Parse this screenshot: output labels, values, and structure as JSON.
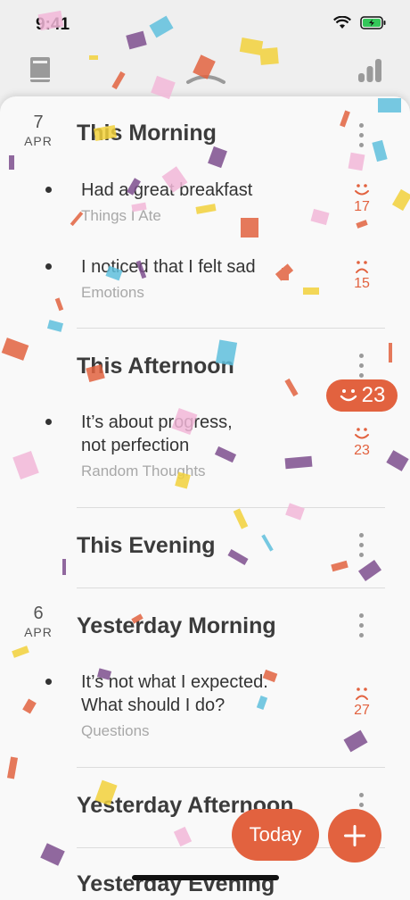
{
  "status": {
    "time": "9:41"
  },
  "nav": {
    "left_icon": "book-icon",
    "center_icon": "sunrise-icon",
    "right_icon": "bar-chart-icon"
  },
  "colors": {
    "accent": "#e2623f",
    "background": "#f9f9f9"
  },
  "sections": [
    {
      "day": "7",
      "month": "APR",
      "title": "This Morning"
    },
    {
      "title": "This Afternoon"
    },
    {
      "title": "This Evening"
    },
    {
      "day": "6",
      "month": "APR",
      "title": "Yesterday Morning"
    },
    {
      "title": "Yesterday Afternoon"
    },
    {
      "title": "Yesterday Evening"
    }
  ],
  "entries": [
    {
      "text": "Had a great breakfast",
      "category": "Things I Ate",
      "mood": "happy",
      "score": "17"
    },
    {
      "text": "I noticed that I felt sad",
      "category": "Emotions",
      "mood": "sad",
      "score": "15"
    },
    {
      "text_line1": "It’s about progress,",
      "text_line2": "not perfection",
      "category": "Random Thoughts",
      "mood": "happy",
      "score": "23"
    },
    {
      "text_line1": "It’s not what I expected.",
      "text_line2": "What should I do?",
      "category": "Questions",
      "mood": "sad",
      "score": "27"
    }
  ],
  "score_pill": {
    "value": "23",
    "icon": "smile-icon"
  },
  "buttons": {
    "today": "Today",
    "add_icon": "plus-icon"
  }
}
